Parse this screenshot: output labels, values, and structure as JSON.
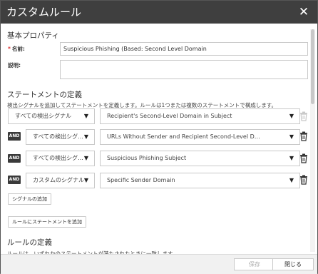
{
  "dialog": {
    "title": "カスタムルール",
    "close_glyph": "✕"
  },
  "basic": {
    "heading": "基本プロパティ",
    "name_required_mark": "*",
    "name_label": "名前:",
    "name_value": "Suspicious Phishing (Based: Second Level Domain",
    "desc_label": "説明:",
    "desc_value": ""
  },
  "statements": {
    "heading": "ステートメントの定義",
    "description": "検出シグナルを追加してステートメントを定義します。ルールは1つまたは複数のステートメントで構成します。",
    "and_label": "AND",
    "rows": [
      {
        "type": "すべての検出シグナル",
        "signal": "Recipient's Second-Level Domain in Subject",
        "has_and": false
      },
      {
        "type": "すべての検出シグ...",
        "signal": "URLs Without Sender and Recipient Second-Level D…",
        "has_and": true
      },
      {
        "type": "すべての検出シグ...",
        "signal": "Suspicious Phishing Subject",
        "has_and": true
      },
      {
        "type": "カスタムのシグナル",
        "signal": "Specific Sender Domain",
        "has_and": true
      }
    ],
    "add_signal_button": "シグナルの追加",
    "add_statement_button": "ルールにステートメントを追加"
  },
  "rule_def": {
    "heading": "ルールの定義",
    "partial_text": "ルールは、いずれかのステートメントが満たされたときに一致します"
  },
  "footer": {
    "save_label": "保存",
    "close_label": "閉じる"
  },
  "icons": {
    "dropdown": "chevron-down-icon",
    "delete": "trash-icon"
  },
  "colors": {
    "titlebar": "#3f3f3f",
    "and_badge": "#3a3a3a",
    "required": "#dd3333",
    "trash_disabled": "#c8c8c8",
    "trash_enabled": "#333333"
  }
}
